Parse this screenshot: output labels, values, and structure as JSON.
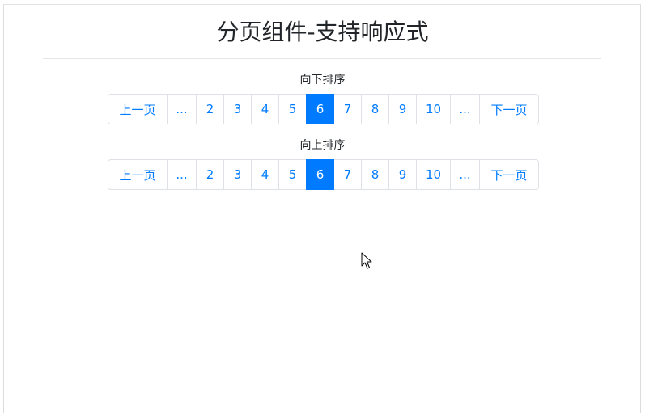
{
  "page": {
    "title": "分页组件-支持响应式"
  },
  "sections": [
    {
      "label": "向下排序",
      "pagination": {
        "prev": "上一页",
        "items": [
          "...",
          "2",
          "3",
          "4",
          "5",
          "6",
          "7",
          "8",
          "9",
          "10",
          "..."
        ],
        "active": "6",
        "next": "下一页"
      }
    },
    {
      "label": "向上排序",
      "pagination": {
        "prev": "上一页",
        "items": [
          "...",
          "2",
          "3",
          "4",
          "5",
          "6",
          "7",
          "8",
          "9",
          "10",
          "..."
        ],
        "active": "6",
        "next": "下一页"
      }
    }
  ],
  "colors": {
    "accent": "#007bff",
    "border": "#dee2e6",
    "text": "#212529"
  },
  "icons": {
    "cursor": "mouse-pointer-icon"
  }
}
